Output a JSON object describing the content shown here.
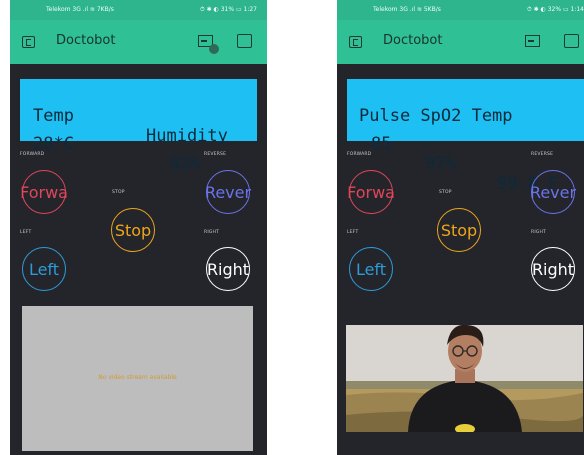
{
  "screens": [
    {
      "status": {
        "carrier": "Telekom 3G  .ıl ≋ 7KB/s",
        "system": "⏱ ✱ ◐ 31% ▭ 1:27"
      },
      "app": {
        "title": "Doctobot"
      },
      "lcd": {
        "row1": {
          "left": "Temp",
          "right": "Humidity"
        },
        "row2": {
          "left": "28*C",
          "right": "82%"
        }
      },
      "labels": {
        "forward": "FORWARD",
        "reverse": "REVERSE",
        "stop": "STOP",
        "left": "LEFT",
        "right": "RIGHT"
      },
      "buttons": {
        "forward": "Forwa",
        "reverse": "Rever",
        "stop": "Stop",
        "left": "Left",
        "right": "Right"
      },
      "video": {
        "placeholder": "No video stream available"
      }
    },
    {
      "status": {
        "carrier": "Telekom 3G  .ıl ≋ 5KB/s",
        "system": "⏱ ✱ ◐ 32% ▭ 1:14"
      },
      "app": {
        "title": "Doctobot"
      },
      "lcd": {
        "row1": "Pulse SpO2 Temp",
        "row2": {
          "a": "85",
          "b": "97%",
          "c": "99.8 F"
        }
      },
      "labels": {
        "forward": "FORWARD",
        "reverse": "REVERSE",
        "stop": "STOP",
        "left": "LEFT",
        "right": "RIGHT"
      },
      "buttons": {
        "forward": "Forwa",
        "reverse": "Rever",
        "stop": "Stop",
        "left": "Left",
        "right": "Right"
      }
    }
  ],
  "colors": {
    "header": "#30c095",
    "lcd_background": "#1ec0f3",
    "forward": "#e0465a",
    "reverse": "#6c73e8",
    "stop": "#efa51c",
    "left": "#2e9bd9",
    "right": "#ffffff"
  },
  "icons": [
    "exit-icon",
    "board-icon",
    "square-icon",
    "touch-indicator"
  ]
}
